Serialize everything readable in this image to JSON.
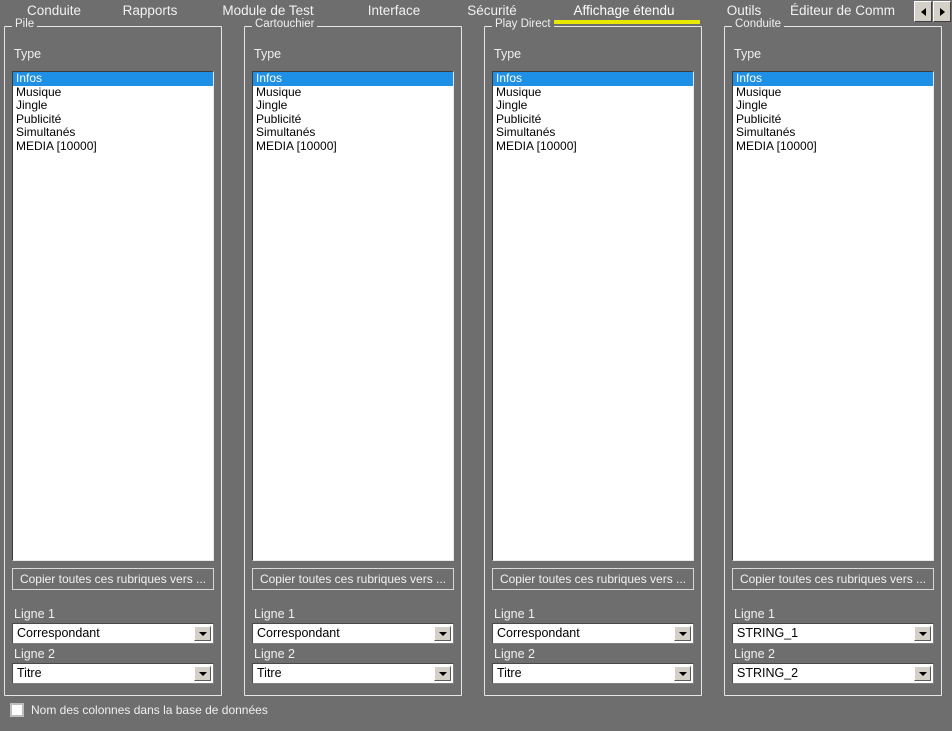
{
  "window": {
    "background_color": "#6e6e6e",
    "accent_color": "#e8e800",
    "selection_color": "#1e90e6"
  },
  "tabs": {
    "items": [
      {
        "label": "Conduite",
        "active": false
      },
      {
        "label": "Rapports",
        "active": false
      },
      {
        "label": "Module de Test",
        "active": false
      },
      {
        "label": "Interface",
        "active": false
      },
      {
        "label": "Sécurité",
        "active": false
      },
      {
        "label": "Affichage étendu",
        "active": true
      },
      {
        "label": "Outils",
        "active": false
      },
      {
        "label": "Éditeur de Comm",
        "active": false
      }
    ],
    "nav_prev_icon": "chevron-left-icon",
    "nav_next_icon": "chevron-right-icon"
  },
  "panels": [
    {
      "title": "Pile",
      "type_label": "Type",
      "list_items": [
        "Infos",
        "Musique",
        "Jingle",
        "Publicité",
        "Simultanés",
        "MEDIA [10000]"
      ],
      "selected_index": 0,
      "copy_button": "Copier toutes ces rubriques vers ...",
      "line1_label": "Ligne 1",
      "line1_value": "Correspondant",
      "line2_label": "Ligne 2",
      "line2_value": "Titre"
    },
    {
      "title": "Cartouchier",
      "type_label": "Type",
      "list_items": [
        "Infos",
        "Musique",
        "Jingle",
        "Publicité",
        "Simultanés",
        "MEDIA [10000]"
      ],
      "selected_index": 0,
      "copy_button": "Copier toutes ces rubriques vers ...",
      "line1_label": "Ligne 1",
      "line1_value": "Correspondant",
      "line2_label": "Ligne 2",
      "line2_value": "Titre"
    },
    {
      "title": "Play Direct",
      "type_label": "Type",
      "list_items": [
        "Infos",
        "Musique",
        "Jingle",
        "Publicité",
        "Simultanés",
        "MEDIA [10000]"
      ],
      "selected_index": 0,
      "copy_button": "Copier toutes ces rubriques vers ...",
      "line1_label": "Ligne 1",
      "line1_value": "Correspondant",
      "line2_label": "Ligne 2",
      "line2_value": "Titre"
    },
    {
      "title": "Conduite",
      "type_label": "Type",
      "list_items": [
        "Infos",
        "Musique",
        "Jingle",
        "Publicité",
        "Simultanés",
        "MEDIA [10000]"
      ],
      "selected_index": 0,
      "copy_button": "Copier toutes ces rubriques vers ...",
      "line1_label": "Ligne 1",
      "line1_value": "STRING_1",
      "line2_label": "Ligne 2",
      "line2_value": "STRING_2"
    }
  ],
  "footer": {
    "checkbox_label": "Nom des colonnes dans la base de données",
    "checkbox_checked": false
  }
}
